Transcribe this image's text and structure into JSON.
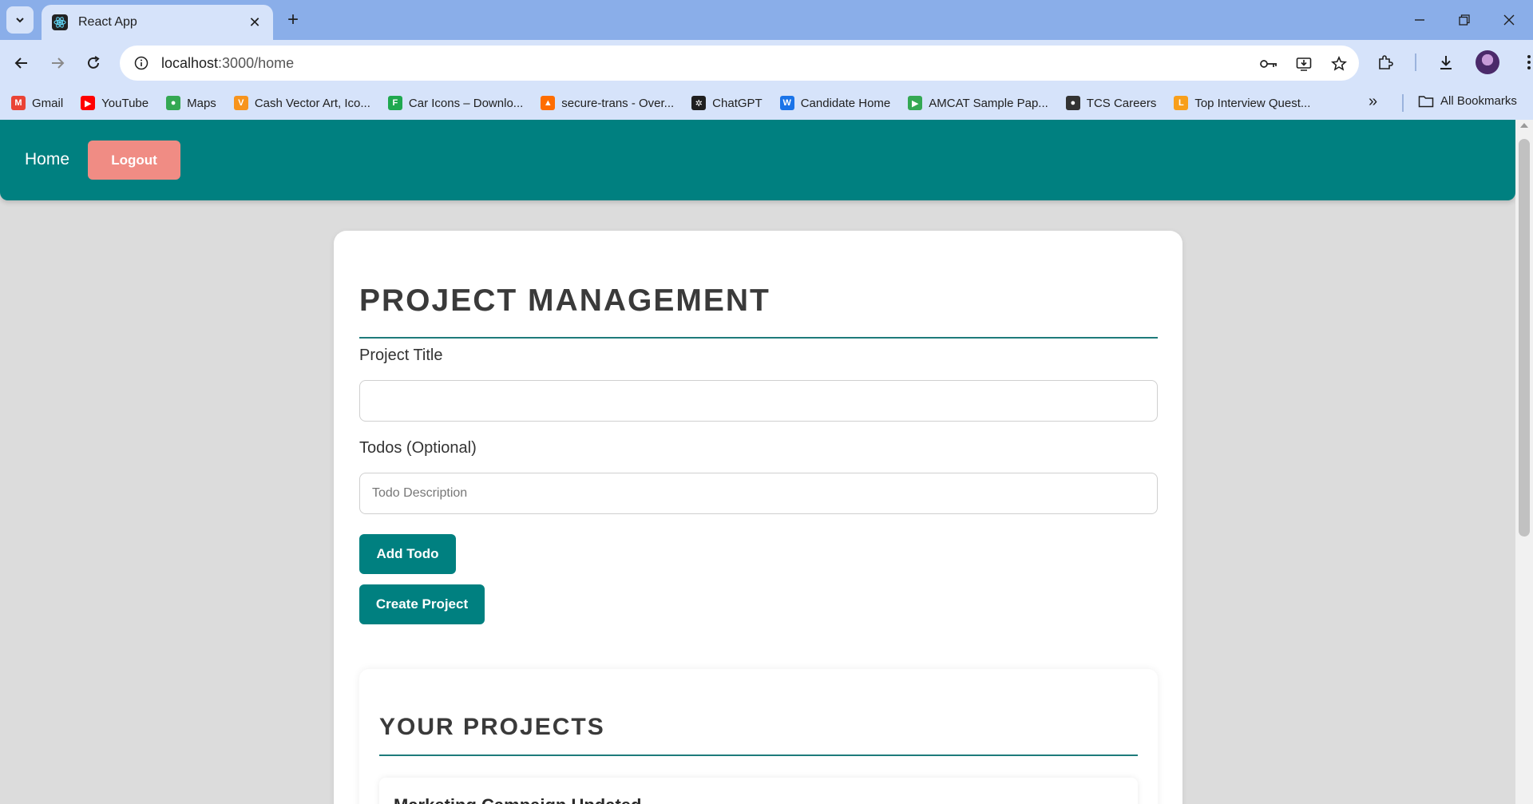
{
  "browser": {
    "tab_title": "React App",
    "url_host": "localhost",
    "url_rest": ":3000/home",
    "bookmarks": [
      {
        "label": "Gmail",
        "icon": "gmail-icon",
        "color": "#ea4335"
      },
      {
        "label": "YouTube",
        "icon": "youtube-icon",
        "color": "#ff0000"
      },
      {
        "label": "Maps",
        "icon": "maps-icon",
        "color": "#34a853"
      },
      {
        "label": "Cash Vector Art, Ico...",
        "icon": "vecteezy-icon",
        "color": "#f7941d"
      },
      {
        "label": "Car Icons – Downlo...",
        "icon": "flaticon-icon",
        "color": "#1fa84f"
      },
      {
        "label": "secure-trans - Over...",
        "icon": "firebase-icon",
        "color": "#ff6d00"
      },
      {
        "label": "ChatGPT",
        "icon": "chatgpt-icon",
        "color": "#1f1f1f"
      },
      {
        "label": "Candidate Home",
        "icon": "candidate-icon",
        "color": "#1a73e8"
      },
      {
        "label": "AMCAT Sample Pap...",
        "icon": "amcat-icon",
        "color": "#34a853"
      },
      {
        "label": "TCS Careers",
        "icon": "globe-icon",
        "color": "#333333"
      },
      {
        "label": "Top Interview Quest...",
        "icon": "leetcode-icon",
        "color": "#f89f1b"
      }
    ],
    "all_bookmarks": "All Bookmarks"
  },
  "nav": {
    "home": "Home",
    "logout": "Logout"
  },
  "form": {
    "heading": "PROJECT MANAGEMENT",
    "title_label": "Project Title",
    "title_value": "",
    "todos_label": "Todos (Optional)",
    "todo_placeholder": "Todo Description",
    "add_todo": "Add Todo",
    "create_project": "Create Project"
  },
  "projects": {
    "heading": "YOUR PROJECTS",
    "items": [
      {
        "title": "Marketing Campaign Updated"
      }
    ]
  },
  "colors": {
    "primary": "#008080",
    "logout": "#f08c84",
    "tabstrip": "#8aaee9",
    "toolbar": "#d6e3fa"
  }
}
